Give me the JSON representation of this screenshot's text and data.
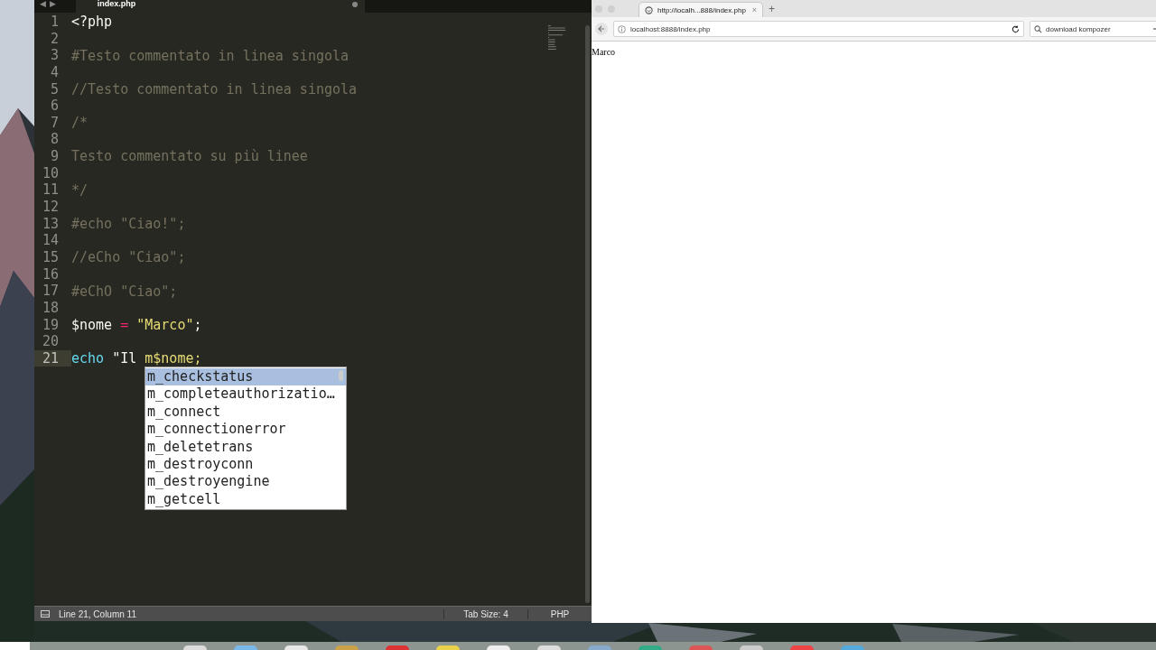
{
  "editor": {
    "nav": [
      "◀",
      "▶"
    ],
    "tab": {
      "label": "index.php",
      "modified": true
    },
    "lines": [
      {
        "number": "1",
        "current": false,
        "tokens": [
          {
            "kind": "tag",
            "text": "<?php"
          }
        ]
      },
      {
        "number": "2",
        "current": false
      },
      {
        "number": "3",
        "current": false,
        "tokens": [
          {
            "kind": "comment",
            "text": "#Testo commentato in linea singola"
          }
        ]
      },
      {
        "number": "4",
        "current": false
      },
      {
        "number": "5",
        "current": false,
        "tokens": [
          {
            "kind": "comment",
            "text": "//Testo commentato in linea singola"
          }
        ]
      },
      {
        "number": "6",
        "current": false
      },
      {
        "number": "7",
        "current": false,
        "tokens": [
          {
            "kind": "comment",
            "text": "/*"
          }
        ]
      },
      {
        "number": "8",
        "current": false
      },
      {
        "number": "9",
        "current": false,
        "tokens": [
          {
            "kind": "comment",
            "text": "Testo commentato su più linee"
          }
        ]
      },
      {
        "number": "10",
        "current": false
      },
      {
        "number": "11",
        "current": false,
        "tokens": [
          {
            "kind": "comment",
            "text": "*/"
          }
        ]
      },
      {
        "number": "12",
        "current": false
      },
      {
        "number": "13",
        "current": false,
        "tokens": [
          {
            "kind": "comment",
            "text": "#echo \"Ciao!\";"
          }
        ]
      },
      {
        "number": "14",
        "current": false
      },
      {
        "number": "15",
        "current": false,
        "tokens": [
          {
            "kind": "comment",
            "text": "//eCho \"Ciao\";"
          }
        ]
      },
      {
        "number": "16",
        "current": false
      },
      {
        "number": "17",
        "current": false,
        "tokens": [
          {
            "kind": "comment",
            "text": "#eChO \"Ciao\";"
          }
        ]
      },
      {
        "number": "18",
        "current": false
      },
      {
        "number": "19",
        "current": false,
        "tokens": [
          {
            "kind": "plain",
            "text": "$nome "
          },
          {
            "kind": "operator",
            "text": "= "
          },
          {
            "kind": "string",
            "text": "\"Marco\""
          },
          {
            "kind": "plain",
            "text": ";"
          }
        ]
      },
      {
        "number": "20",
        "current": false
      },
      {
        "number": "21",
        "current": true,
        "tokens": [
          {
            "kind": "keyword",
            "text": "echo"
          },
          {
            "kind": "plain",
            "text": " \"Il "
          },
          {
            "kind": "string",
            "text": "m$nome;"
          }
        ]
      }
    ],
    "completions": [
      {
        "label": "m_checkstatus",
        "selected": true
      },
      {
        "label": "m_completeauthorizatio…",
        "selected": false
      },
      {
        "label": "m_connect",
        "selected": false
      },
      {
        "label": "m_connectionerror",
        "selected": false
      },
      {
        "label": "m_deletetrans",
        "selected": false
      },
      {
        "label": "m_destroyconn",
        "selected": false
      },
      {
        "label": "m_destroyengine",
        "selected": false
      },
      {
        "label": "m_getcell",
        "selected": false
      }
    ],
    "status_bar": {
      "position": "Line 21, Column 11",
      "tab_size": "Tab Size: 4",
      "syntax": "PHP"
    }
  },
  "browser": {
    "tab": {
      "title": "http://localh...888/index.php",
      "close": "×"
    },
    "new_tab": "+",
    "address": "localhost:8888/index.php",
    "search": "download kompozer",
    "page_text": "Marco"
  }
}
